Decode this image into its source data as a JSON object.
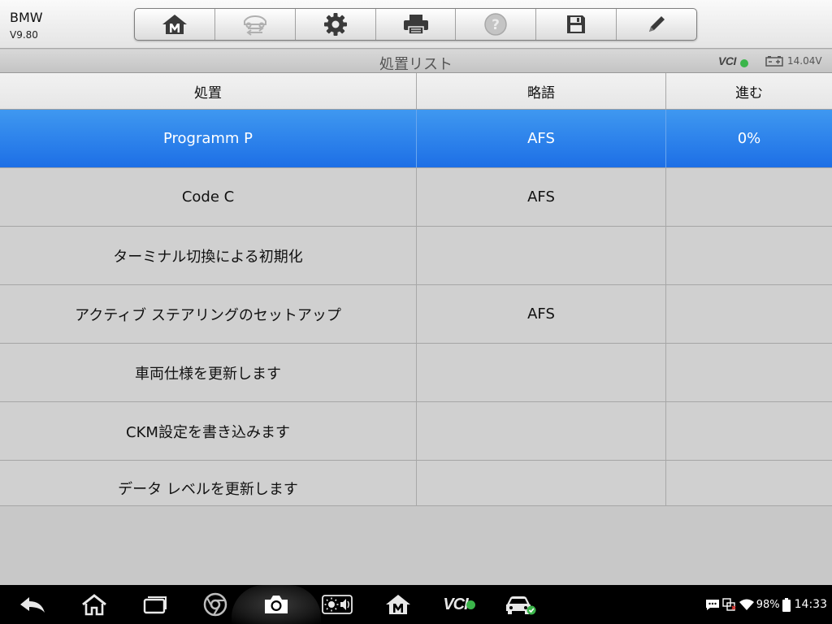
{
  "header": {
    "app_title": "BMW",
    "version": "V9.80",
    "toolbar": [
      {
        "name": "home-button",
        "icon": "autel-home-icon"
      },
      {
        "name": "vehicle-swap-button",
        "icon": "vehicle-swap-icon",
        "disabled": true
      },
      {
        "name": "settings-button",
        "icon": "gear-icon"
      },
      {
        "name": "print-button",
        "icon": "printer-icon"
      },
      {
        "name": "help-button",
        "icon": "help-icon",
        "disabled": true
      },
      {
        "name": "save-button",
        "icon": "floppy-icon"
      },
      {
        "name": "edit-button",
        "icon": "pencil-icon"
      }
    ]
  },
  "titlebar": {
    "title": "処置リスト",
    "vci_label": "VCI",
    "voltage": "14.04V"
  },
  "table": {
    "headers": [
      "処置",
      "略語",
      "進む"
    ],
    "rows": [
      {
        "action": "Programm P",
        "abbr": "AFS",
        "progress": "0%",
        "selected": true
      },
      {
        "action": "Code C",
        "abbr": "AFS",
        "progress": ""
      },
      {
        "action": "ターミナル切換による初期化",
        "abbr": "",
        "progress": ""
      },
      {
        "action": "アクティブ ステアリングのセットアップ",
        "abbr": "AFS",
        "progress": ""
      },
      {
        "action": "車両仕様を更新します",
        "abbr": "",
        "progress": ""
      },
      {
        "action": "CKM設定を書き込みます",
        "abbr": "",
        "progress": ""
      },
      {
        "action": "データ レベルを更新します",
        "abbr": "",
        "progress": ""
      }
    ]
  },
  "navbar": {
    "vci_label": "VCI",
    "battery": "98%",
    "time": "14:33"
  },
  "colors": {
    "selected_row": "#2a82ea",
    "row_bg": "#d0d0d0",
    "status_green": "#3bb54a"
  }
}
